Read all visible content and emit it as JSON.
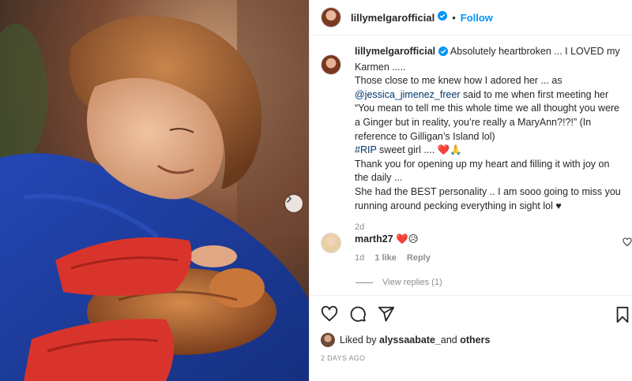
{
  "post": {
    "username": "lillymelgarofficial",
    "follow_label": "Follow",
    "dot": "•"
  },
  "caption": {
    "username": "lillymelgarofficial",
    "line1": "Absolutely heartbroken ... I LOVED my Karmen .....",
    "line2_pre": "Those close to me knew how I adored her ... as ",
    "mention": "@jessica_jimenez_freer",
    "line2_post": " said to me when first meeting her “You mean to tell me this whole time we all thought you were a Ginger but in reality, you’re really a MaryAnn?!?!” (In reference to Gilligan’s Island lol)",
    "hashtag": "#RIP",
    "line3_post": " sweet girl .... ❤️🙏",
    "line4": "Thank you for opening up my heart and filling it with joy on the daily ...",
    "line5": "She had the BEST personality .. I am sooo going to miss you running around pecking everything in sight lol ♥",
    "time": "2d"
  },
  "comment": {
    "username": "marth27",
    "text": " ❤️😥",
    "time": "1d",
    "likes": "1 like",
    "reply_label": "Reply",
    "view_replies": "View replies (1)"
  },
  "likes": {
    "prefix": "Liked by ",
    "user": "alyssaabate_",
    "middle": " and ",
    "others": "others"
  },
  "date": "2 DAYS AGO",
  "icons": {
    "header_avatar": "avatar",
    "verified": "verified-badge-icon",
    "next": "chevron-right-icon",
    "like": "heart-icon",
    "comment": "comment-bubble-icon",
    "share": "paper-plane-icon",
    "save": "bookmark-icon"
  },
  "colors": {
    "link": "#0095f6",
    "mention": "#00376b",
    "muted": "#8e8e8e",
    "jersey": "#1f3fa6",
    "wrap": "#d9342b"
  }
}
